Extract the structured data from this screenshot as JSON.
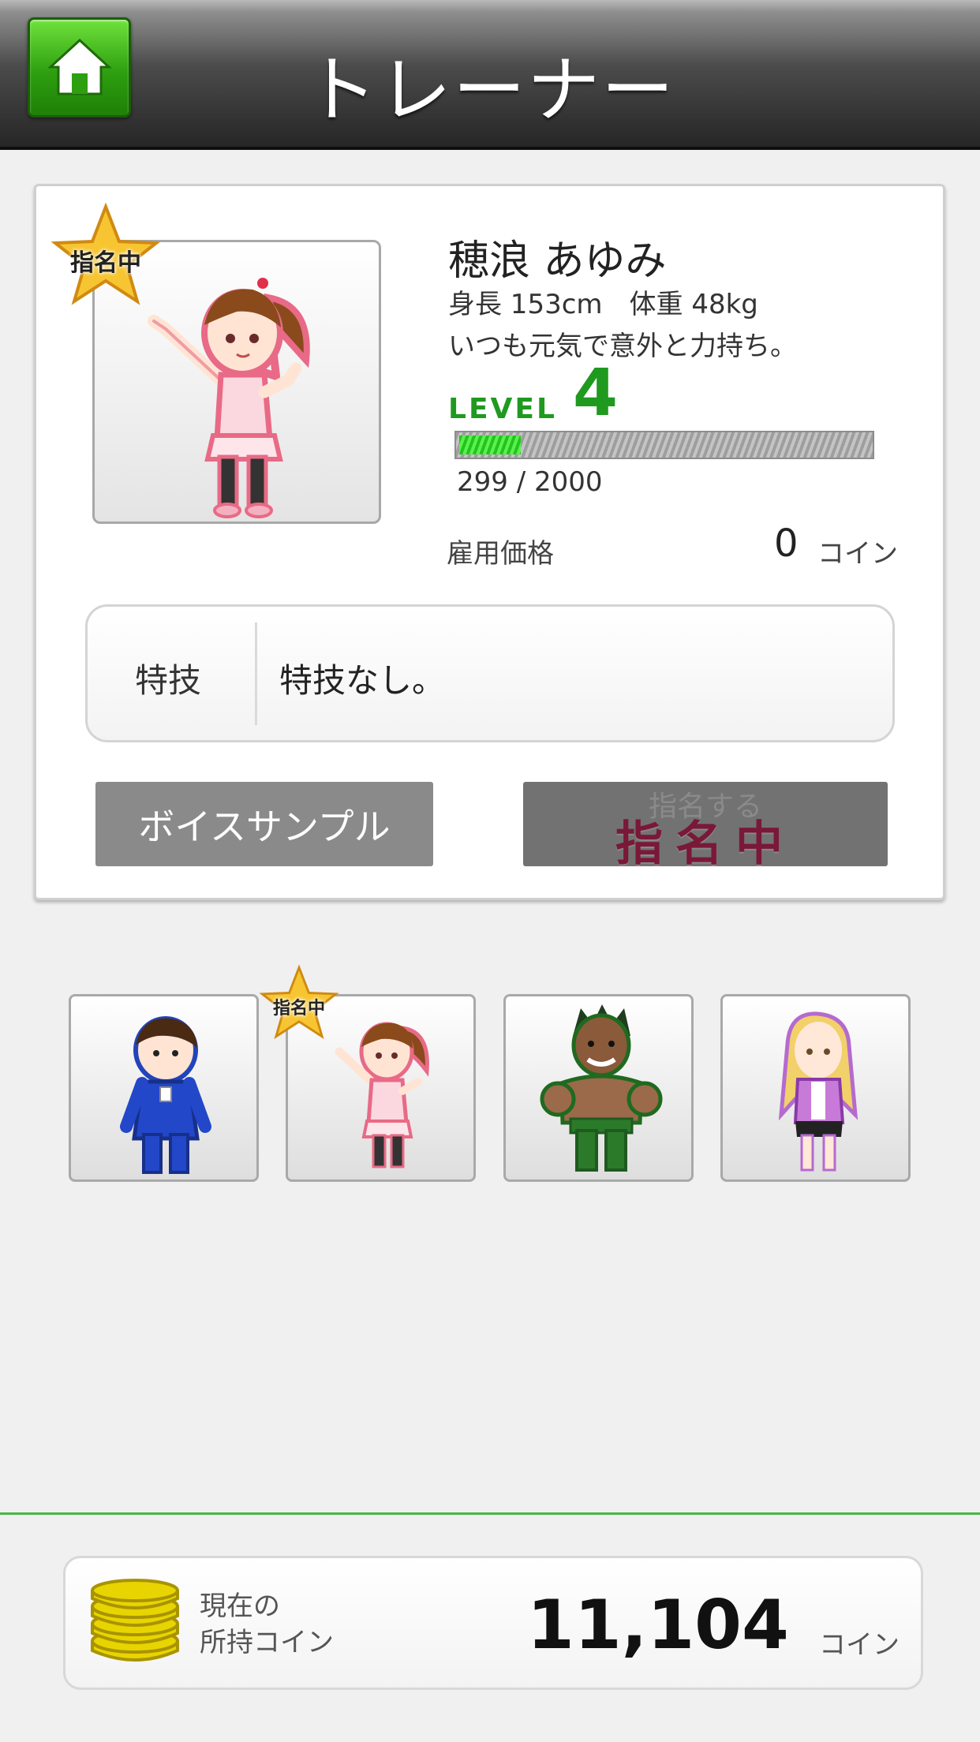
{
  "header": {
    "title": "トレーナー",
    "home_icon": "home-icon"
  },
  "trainer": {
    "badge": "指名中",
    "name": "穂浪 あゆみ",
    "stats": "身長 153cm　体重 48kg",
    "description": "いつも元気で意外と力持ち。",
    "level_label": "LEVEL",
    "level": "4",
    "xp_text": "299 / 2000",
    "xp_fraction": 0.15,
    "price_label": "雇用価格",
    "price_value": "0",
    "price_unit": "コイン",
    "skill_label": "特技",
    "skill_value": "特技なし。"
  },
  "buttons": {
    "voice_sample": "ボイスサンプル",
    "nominate_ghost": "指名する",
    "nominate_active": "指名中"
  },
  "thumbnails": [
    {
      "name": "trainer-thumb-1",
      "selected": false
    },
    {
      "name": "trainer-thumb-2",
      "selected": true,
      "badge": "指名中"
    },
    {
      "name": "trainer-thumb-3",
      "selected": false
    },
    {
      "name": "trainer-thumb-4",
      "selected": false
    }
  ],
  "footer": {
    "coin_label_line1": "現在の",
    "coin_label_line2": "所持コイン",
    "coin_value": "11,104",
    "coin_unit": "コイン"
  },
  "colors": {
    "level_green": "#1f9a1f",
    "nominate_text": "#7a1838",
    "footer_line": "#45b845"
  }
}
